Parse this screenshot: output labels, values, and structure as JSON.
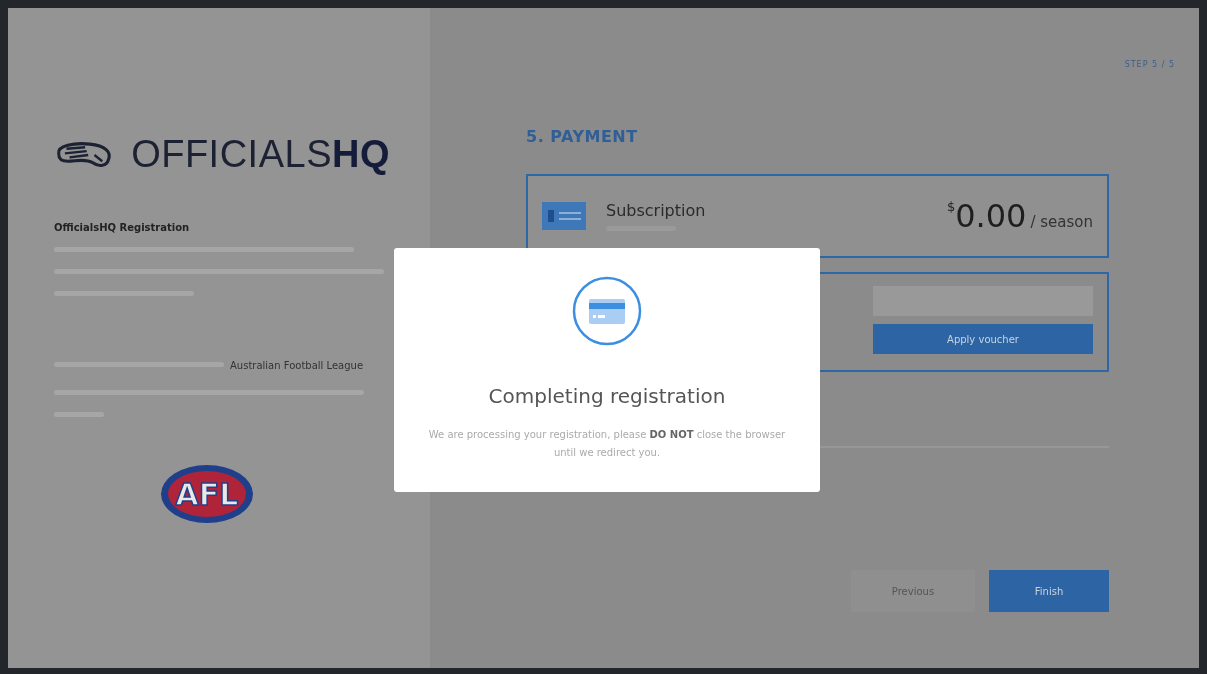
{
  "brand": {
    "logo": "OFFICIALS**HQ**"
  },
  "intro": {
    "title": "OfficialsHQ Registration",
    "highlight": "Australian Football League"
  },
  "partner_logo": {
    "text": "AFL"
  },
  "step_label": "STEP 5 / 5",
  "section_title": "5. PAYMENT",
  "subscription": {
    "name": "Subscription",
    "currency": "$",
    "amount": "0.00",
    "period": "/ season"
  },
  "voucher": {
    "button": "Apply voucher"
  },
  "nav": {
    "previous": "Previous",
    "finish": "Finish"
  },
  "modal": {
    "title": "Completing registration",
    "message": "We are processing your registration, please **DO NOT** close the browser until we redirect you."
  }
}
